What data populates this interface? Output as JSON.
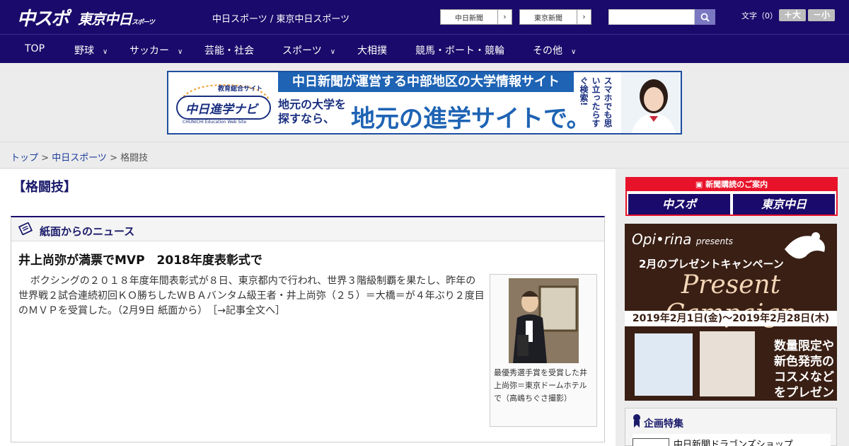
{
  "header": {
    "logo_chuspo": "中スポ",
    "logo_tokyo": "東京中日",
    "logo_tokyo_sub": "スポーツ",
    "site_title": "中日スポーツ / 東京中日スポーツ",
    "links": [
      {
        "label": "中日新聞",
        "arrow": "›"
      },
      {
        "label": "東京新聞",
        "arrow": "›"
      }
    ],
    "search_placeholder": "",
    "font_size_label": "文字（0）",
    "font_bigger": "＋大",
    "font_smaller": "－小"
  },
  "nav": {
    "items": [
      {
        "label": "TOP",
        "has_menu": false
      },
      {
        "label": "野球",
        "has_menu": true
      },
      {
        "label": "サッカー",
        "has_menu": true
      },
      {
        "label": "芸能・社会",
        "has_menu": false
      },
      {
        "label": "スポーツ",
        "has_menu": true
      },
      {
        "label": "大相撲",
        "has_menu": false
      },
      {
        "label": "競馬・ボート・競輪",
        "has_menu": false
      },
      {
        "label": "その他",
        "has_menu": true
      }
    ],
    "chevron": "∨"
  },
  "top_ad": {
    "logo_top": "教育総合サイト",
    "logo_main": "中日進学ナビ",
    "logo_sub": "CHUNICHI Education Web Site",
    "band": "中日新聞が運営する中部地区の大学情報サイト",
    "line1a": "地元の大学を",
    "line1b": "探すなら、",
    "line2": "地元の進学サイトで。",
    "vertical": "スマホでも思い立ったらすぐ検索!"
  },
  "breadcrumb": {
    "items": [
      "トップ",
      "中日スポーツ",
      "格闘技"
    ],
    "separator": " > "
  },
  "page": {
    "title": "【格闘技】"
  },
  "news": {
    "section_title": "紙面からのニュース",
    "article_title": "井上尚弥が満票でMVP　2018年度表彰式で",
    "article_body": "ボクシングの２０１８年度年間表彰式が８日、東京都内で行われ、世界３階級制覇を果たし、昨年の世界戦２試合連続初回ＫＯ勝ちしたＷＢＡバンタム級王者・井上尚弥（２５）＝大橋＝が４年ぶり２度目のＭＶＰを受賞した。（2月9日 紙面から）　［→記事全文へ］",
    "photo_caption": "最優秀選手賞を受賞した井上尚弥＝東京ドームホテルで（高嶋ちぐさ撮影）"
  },
  "sidebar": {
    "subscribe_head": "新聞購読のご案内",
    "subscribe_btn1": "中スポ",
    "subscribe_btn2": "東京中日",
    "ad": {
      "brand": "Opi•rina",
      "brand_suffix": "presents",
      "campaign": "2月のプレゼントキャンペーン",
      "headline": "Present Campaign",
      "period": "2019年2月1日(金)～2019年2月28日(木)",
      "slogan": "数量限定や新色発売のコスメなどをプレゼント!"
    },
    "feature_title": "企画特集",
    "feature_item": "中日新聞ドラゴンズショップ"
  },
  "colors": {
    "header_bg": "#1a0a6b",
    "accent_red": "#e8132b",
    "link_blue": "#1a3c9a"
  }
}
